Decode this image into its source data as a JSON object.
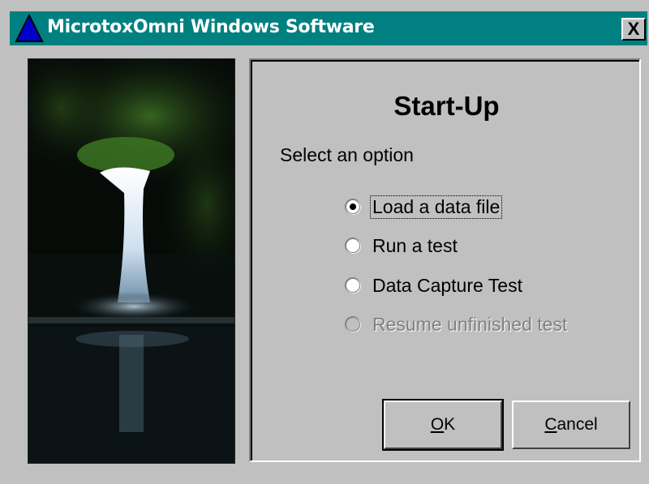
{
  "window": {
    "title": "MicrotoxOmni Windows Software",
    "close_label": "X",
    "colors": {
      "titlebar": "#008080",
      "face": "#c0c0c0"
    }
  },
  "dialog": {
    "heading": "Start-Up",
    "prompt": "Select an option",
    "options": [
      {
        "label": "Load a data file",
        "selected": true,
        "enabled": true
      },
      {
        "label": "Run a test",
        "selected": false,
        "enabled": true
      },
      {
        "label": "Data Capture Test",
        "selected": false,
        "enabled": true
      },
      {
        "label": "Resume unfinished test",
        "selected": false,
        "enabled": false
      }
    ],
    "buttons": {
      "ok_mnemonic": "O",
      "ok_rest": "K",
      "cancel_mnemonic": "C",
      "cancel_rest": "ancel"
    }
  },
  "icons": {
    "app": "blue-triangle-icon",
    "close": "close-icon",
    "image": "waterfall-photo"
  }
}
